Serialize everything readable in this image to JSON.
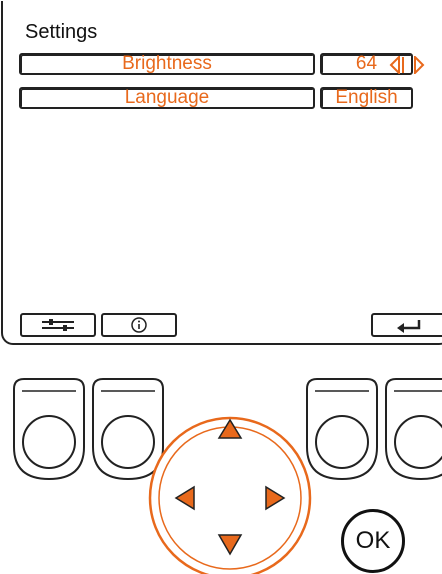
{
  "screen": {
    "title": "Settings",
    "rows": [
      {
        "label": "Brightness",
        "value": "64"
      },
      {
        "label": "Language",
        "value": "English"
      }
    ]
  },
  "buttons": {
    "ok_label": "OK"
  },
  "colors": {
    "accent": "#e8691c",
    "outline": "#222222"
  },
  "icons": [
    "left-right-arrows-icon",
    "sliders-icon",
    "info-icon",
    "back-arrow-icon",
    "dpad-up-icon",
    "dpad-down-icon",
    "dpad-left-icon",
    "dpad-right-icon"
  ]
}
